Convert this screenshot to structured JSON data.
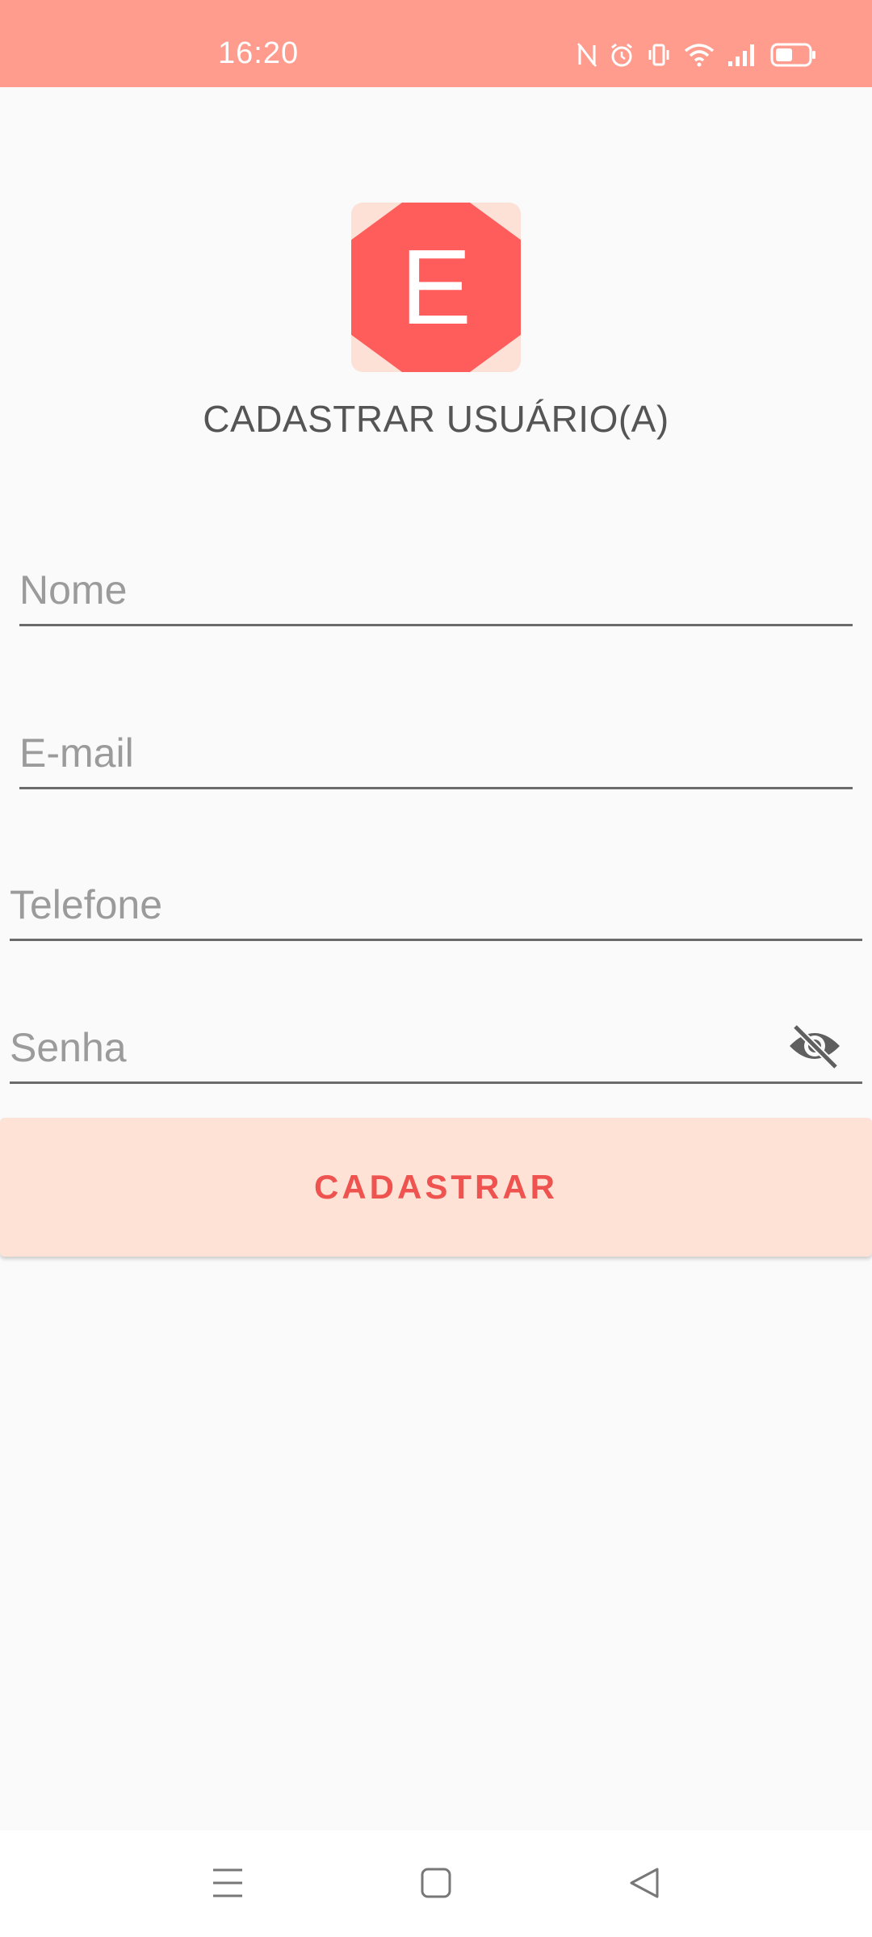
{
  "status_bar": {
    "time": "16:20",
    "icons": [
      "nfc-icon",
      "alarm-icon",
      "vibrate-icon",
      "wifi-icon",
      "signal-icon",
      "battery-icon"
    ],
    "background": "#ff9c8d"
  },
  "logo": {
    "letter": "E",
    "color": "#ff5c5c"
  },
  "page": {
    "title": "CADASTRAR USUÁRIO(A)"
  },
  "form": {
    "nome": {
      "placeholder": "Nome",
      "value": ""
    },
    "email": {
      "placeholder": "E-mail",
      "value": ""
    },
    "telefone": {
      "placeholder": "Telefone",
      "value": ""
    },
    "senha": {
      "placeholder": "Senha",
      "value": "",
      "visibility_icon": "eye-off-icon"
    },
    "submit_label": "CADASTRAR"
  },
  "colors": {
    "accent": "#ef5350",
    "button_background": "#fee2d6"
  },
  "nav_bar": {
    "icons": [
      "menu-icon",
      "home-square-icon",
      "back-triangle-icon"
    ]
  }
}
